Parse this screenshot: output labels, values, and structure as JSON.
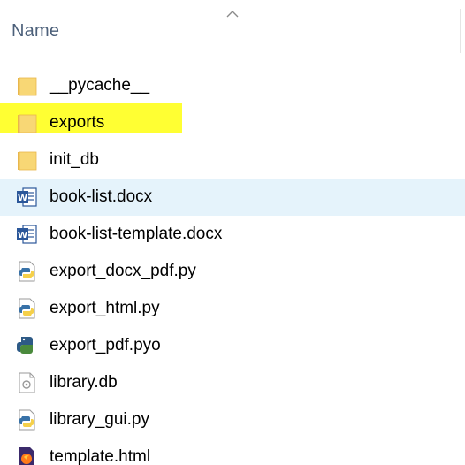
{
  "header": {
    "column_name": "Name",
    "sort_direction": "ascending"
  },
  "colors": {
    "folder": "#f8d775",
    "folder_dark": "#e8b64c",
    "word_blue": "#2b579a",
    "python_blue": "#3872a8",
    "python_yellow": "#f5d04a",
    "selected_row": "#e5f3fb",
    "highlight": "#ffff33"
  },
  "files": [
    {
      "name": "__pycache__",
      "icon": "folder-icon"
    },
    {
      "name": "exports",
      "icon": "folder-icon",
      "highlighted": true
    },
    {
      "name": "init_db",
      "icon": "folder-icon"
    },
    {
      "name": "book-list.docx",
      "icon": "word-doc-icon",
      "selected": true
    },
    {
      "name": "book-list-template.docx",
      "icon": "word-doc-icon"
    },
    {
      "name": "export_docx_pdf.py",
      "icon": "python-file-icon"
    },
    {
      "name": "export_html.py",
      "icon": "python-file-icon"
    },
    {
      "name": "export_pdf.pyo",
      "icon": "python-compiled-icon"
    },
    {
      "name": "library.db",
      "icon": "generic-file-icon"
    },
    {
      "name": "library_gui.py",
      "icon": "python-file-icon"
    },
    {
      "name": "template.html",
      "icon": "firefox-html-icon"
    }
  ]
}
